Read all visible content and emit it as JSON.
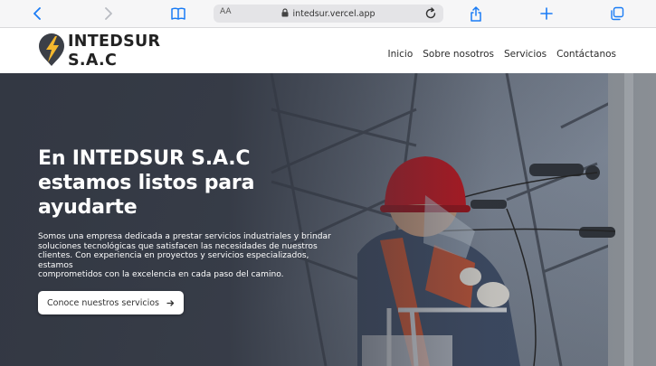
{
  "browser": {
    "text_size_label": "AA",
    "url": "intedsur.vercel.app"
  },
  "header": {
    "logo_line1": "INTEDSUR",
    "logo_line2": "S.A.C",
    "nav": [
      "Inicio",
      "Sobre nosotros",
      "Servicios",
      "Contáctanos"
    ]
  },
  "hero": {
    "title_lines": [
      "En INTEDSUR S.A.C",
      "estamos listos para",
      "ayudarte"
    ],
    "description_lines": [
      "Somos una empresa dedicada a prestar servicios industriales y brindar",
      "soluciones tecnológicas que satisfacen las necesidades de nuestros",
      "clientes. Con experiencia en proyectos y servicios especializados, estamos",
      "comprometidos con la excelencia en cada paso del camino."
    ],
    "cta_label": "Conoce nuestros servicios"
  },
  "colors": {
    "ios_blue": "#1a7cf5",
    "logo_dark": "#3b3f47",
    "logo_yellow": "#f5b82e",
    "hero_overlay": "#323742"
  },
  "icons": [
    "back-icon",
    "forward-icon",
    "bookmarks-icon",
    "lock-icon",
    "reload-icon",
    "share-icon",
    "new-tab-icon",
    "tabs-icon",
    "bolt-logo-icon",
    "arrow-right-icon"
  ]
}
